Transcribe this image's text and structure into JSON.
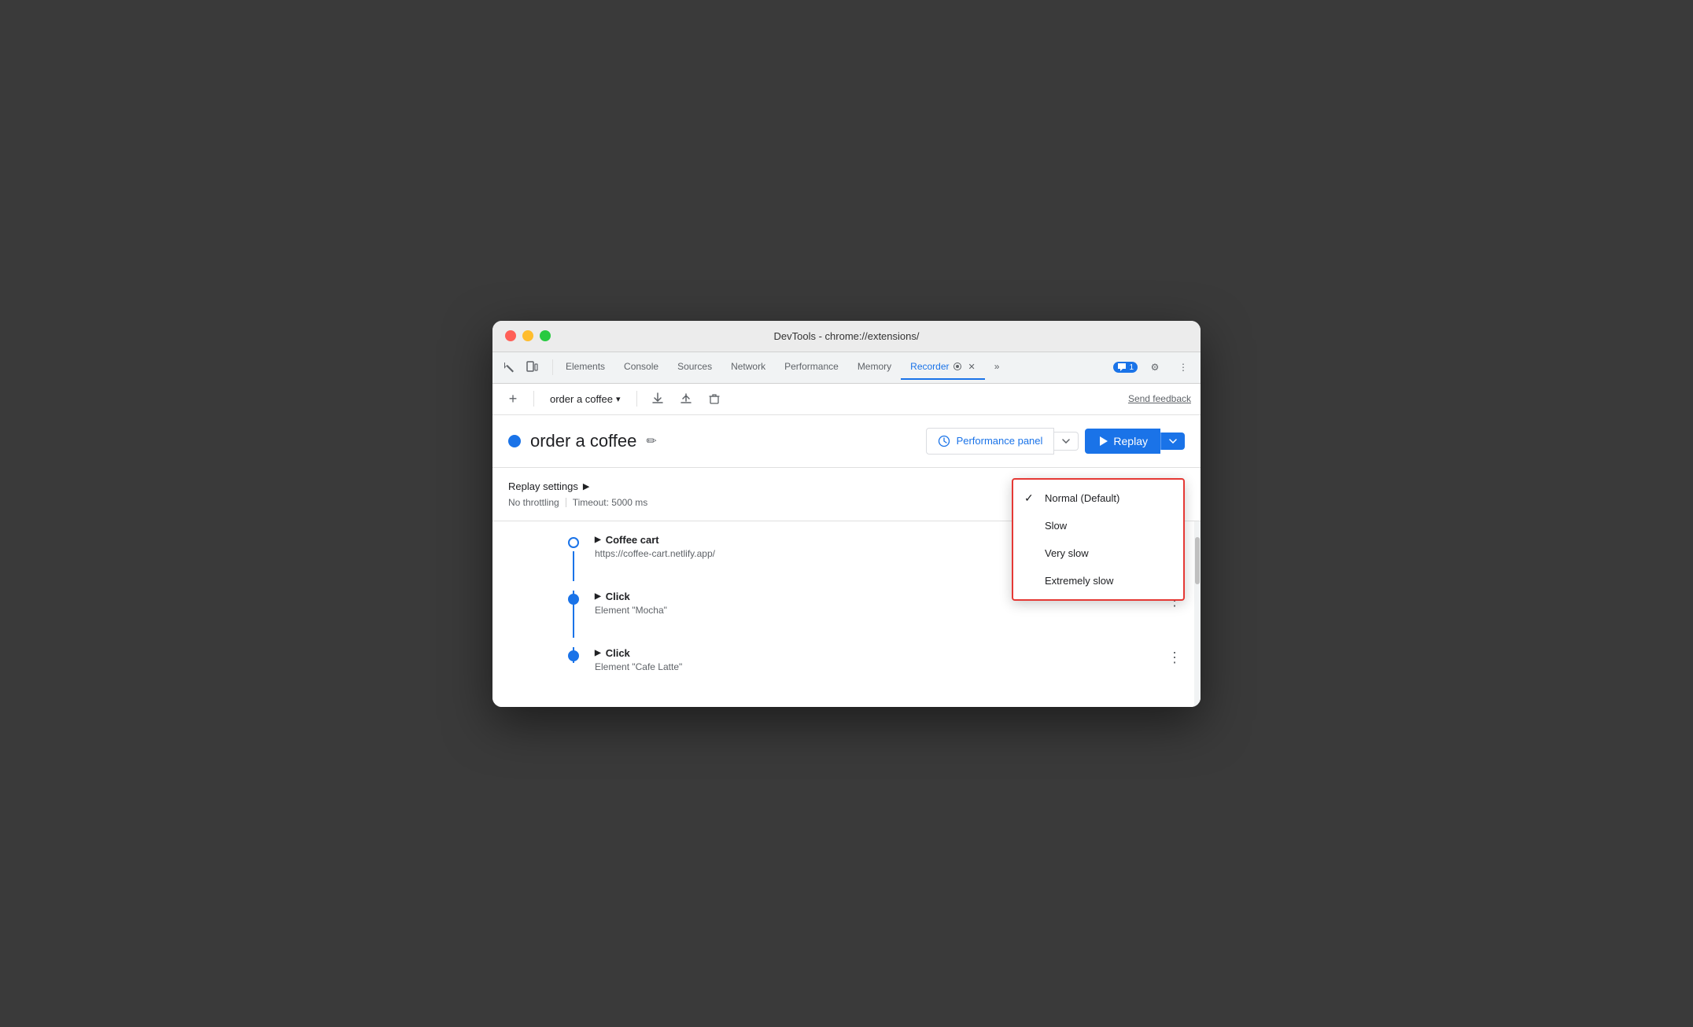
{
  "window": {
    "title": "DevTools - chrome://extensions/"
  },
  "tabs": {
    "items": [
      {
        "label": "Elements",
        "active": false
      },
      {
        "label": "Console",
        "active": false
      },
      {
        "label": "Sources",
        "active": false
      },
      {
        "label": "Network",
        "active": false
      },
      {
        "label": "Performance",
        "active": false
      },
      {
        "label": "Memory",
        "active": false
      },
      {
        "label": "Recorder",
        "active": true
      },
      {
        "label": "»",
        "active": false
      }
    ],
    "chat_badge": "1",
    "settings_icon": "⚙",
    "more_icon": "⋮"
  },
  "toolbar": {
    "add_icon": "+",
    "recording_name": "order a coffee",
    "dropdown_icon": "▾",
    "upload_icon": "↑",
    "download_icon": "↓",
    "delete_icon": "🗑",
    "send_feedback": "Send feedback"
  },
  "recording": {
    "title": "order a coffee",
    "performance_panel_label": "Performance panel",
    "replay_label": "Replay"
  },
  "replay_settings": {
    "title": "Replay settings",
    "no_throttling": "No throttling",
    "timeout": "Timeout: 5000 ms"
  },
  "dropdown": {
    "items": [
      {
        "label": "Normal (Default)",
        "checked": true
      },
      {
        "label": "Slow",
        "checked": false
      },
      {
        "label": "Very slow",
        "checked": false
      },
      {
        "label": "Extremely slow",
        "checked": false
      }
    ]
  },
  "steps": [
    {
      "title": "Coffee cart",
      "subtitle": "https://coffee-cart.netlify.app/",
      "type": "navigate",
      "dot_solid": false
    },
    {
      "title": "Click",
      "subtitle": "Element \"Mocha\"",
      "type": "click",
      "dot_solid": true
    },
    {
      "title": "Click",
      "subtitle": "Element \"Cafe Latte\"",
      "type": "click",
      "dot_solid": true
    }
  ]
}
